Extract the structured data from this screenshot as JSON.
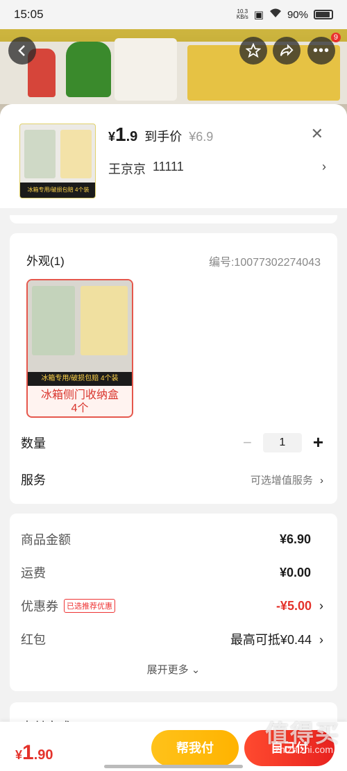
{
  "status": {
    "time": "15:05",
    "speed_top": "10.3",
    "speed_bottom": "KB/s",
    "battery": "90%"
  },
  "nav": {
    "badge": "9"
  },
  "product": {
    "currency": "¥",
    "price_int": "1",
    "price_dec": ".9",
    "deal_label": "到手价",
    "original_price": "¥6.9",
    "shop_name": "王京京",
    "shop_id": "11111",
    "thumb_banner": "冰箱专用/破损包赔 4个装"
  },
  "appearance": {
    "title": "外观(1)",
    "code": "编号:10077302274043",
    "option_banner": "冰箱专用/破损包赔 4个装",
    "option_label_line1": "冰箱侧门收纳盒",
    "option_label_line2": "4个"
  },
  "quantity": {
    "label": "数量",
    "minus": "−",
    "value": "1",
    "plus": "+"
  },
  "service": {
    "label": "服务",
    "link": "可选增值服务"
  },
  "fees": {
    "goods_label": "商品金额",
    "goods_value": "¥6.90",
    "shipping_label": "运费",
    "shipping_value": "¥0.00",
    "coupon_label": "优惠券",
    "coupon_tag": "已选推荐优惠",
    "coupon_value": "-¥5.00",
    "redpack_label": "红包",
    "redpack_value": "最高可抵¥0.44",
    "more": "展开更多"
  },
  "payment": {
    "label": "支付方式"
  },
  "bottom": {
    "currency": "¥",
    "total_int": "1",
    "total_dec": ".90",
    "help_label": "帮我付",
    "pay_label": "自己付"
  },
  "watermark": {
    "text": "值得买",
    "sub": "zhizhizhi.com"
  },
  "colors": {
    "accent_red": "#e4322b",
    "accent_yellow": "#ffb300"
  }
}
